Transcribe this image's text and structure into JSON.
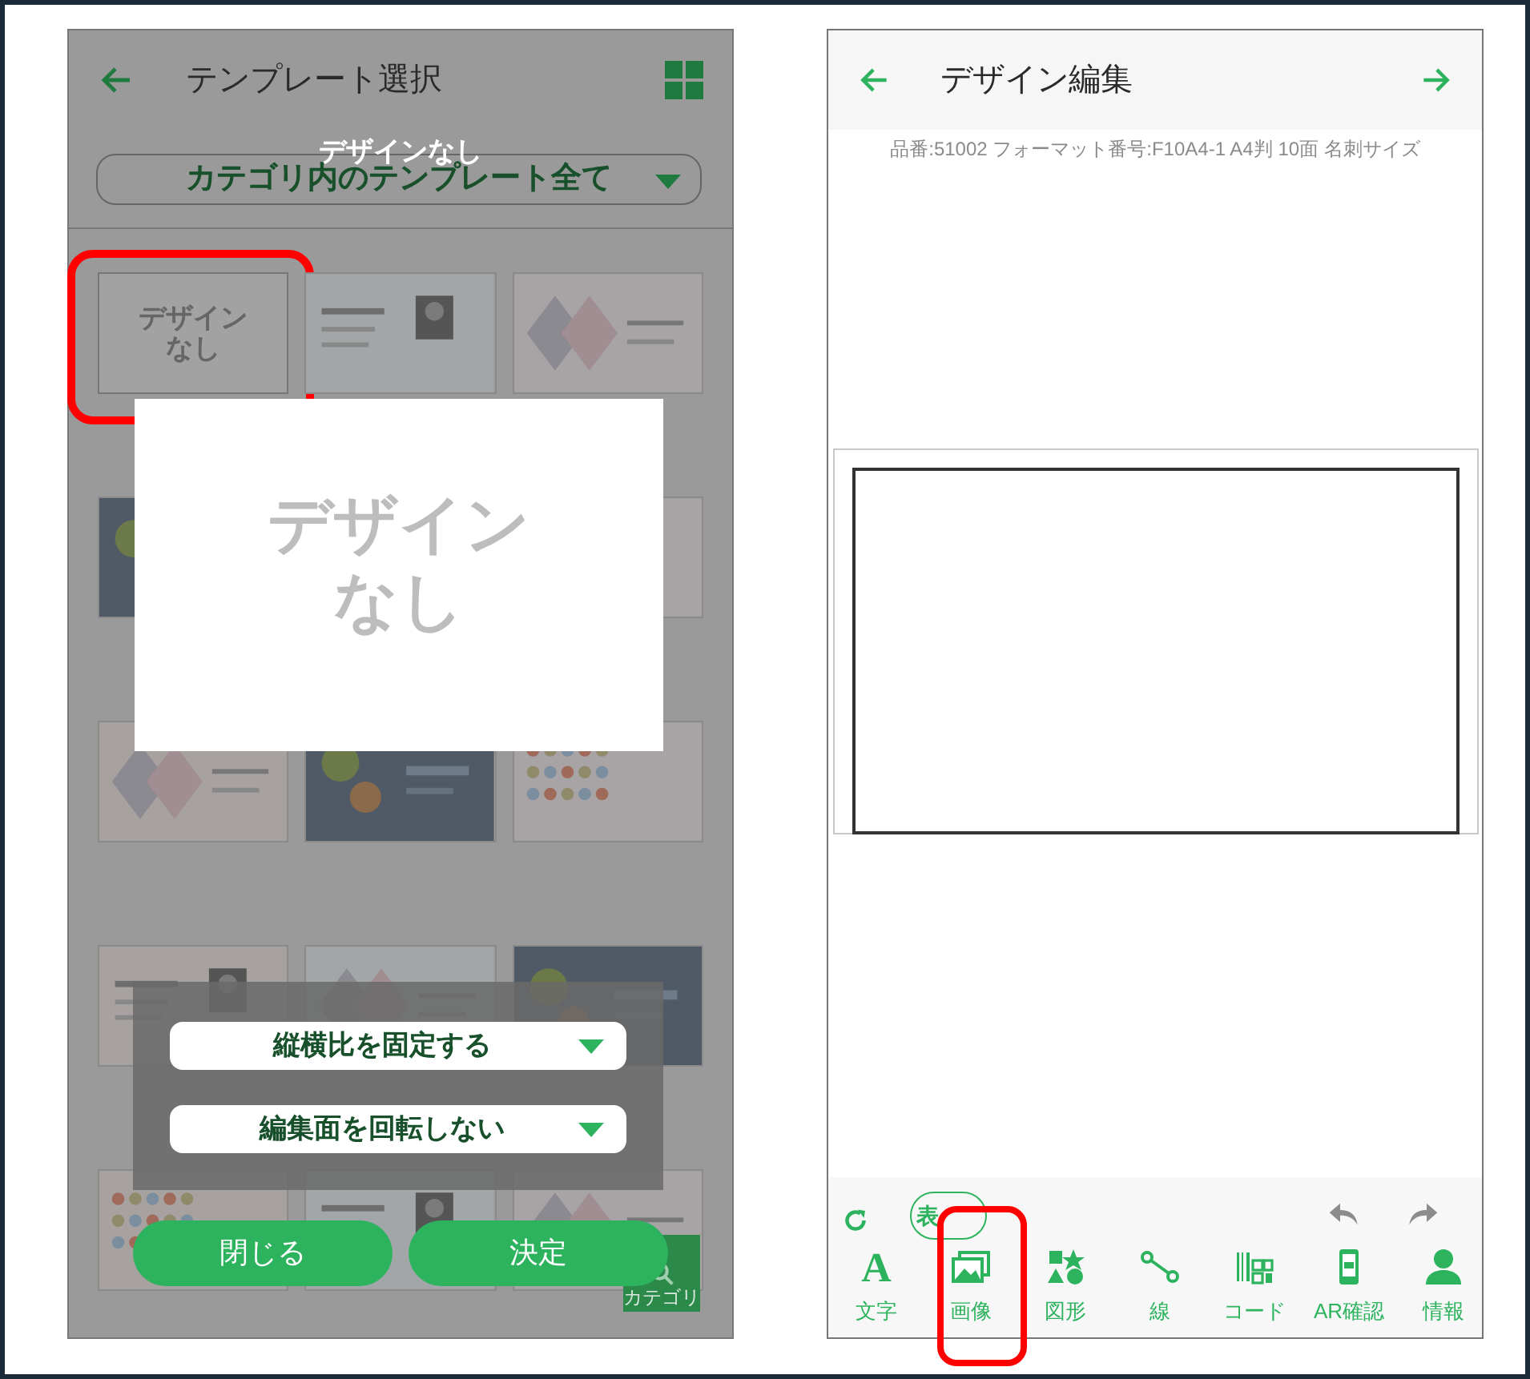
{
  "left_screen": {
    "title": "テンプレート選択",
    "selected_label": "デザインなし",
    "category_dropdown": "カテゴリ内のテンプレート全て",
    "templates": [
      {
        "kind": "blank",
        "label": "デザインなし",
        "highlighted": true
      },
      {
        "kind": "picture",
        "highlighted": false
      },
      {
        "kind": "picture",
        "highlighted": false
      },
      {
        "kind": "picture",
        "highlighted": false
      },
      {
        "kind": "hidden"
      },
      {
        "kind": "picture",
        "highlighted": false
      },
      {
        "kind": "picture",
        "highlighted": false
      },
      {
        "kind": "picture",
        "highlighted": false
      },
      {
        "kind": "picture",
        "highlighted": false
      },
      {
        "kind": "picture",
        "highlighted": false
      },
      {
        "kind": "picture",
        "highlighted": false
      },
      {
        "kind": "picture",
        "highlighted": false
      },
      {
        "kind": "picture",
        "highlighted": false
      },
      {
        "kind": "picture",
        "highlighted": false
      },
      {
        "kind": "picture",
        "highlighted": false
      }
    ],
    "preview": {
      "label": "デザインなし"
    },
    "options": [
      {
        "value": "縦横比を固定する"
      },
      {
        "value": "編集面を回転しない"
      }
    ],
    "buttons": [
      "閉じる",
      "決定"
    ],
    "category_button": "カテゴリ"
  },
  "right_screen": {
    "title": "デザイン編集",
    "info": "品番:51002 フォーマット番号:F10A4-1 A4判 10面 名刺サイズ",
    "side_toggle": "表",
    "tools": [
      {
        "kind": "text",
        "glyph": "A",
        "label": "文字",
        "highlighted": false
      },
      {
        "label": "画像",
        "highlighted": true
      },
      {
        "kind": "shape",
        "label": "図形",
        "highlighted": false
      },
      {
        "kind": "line",
        "label": "線",
        "highlighted": false
      },
      {
        "kind": "code",
        "label": "コード",
        "highlighted": false
      },
      {
        "kind": "ar",
        "label": "AR確認",
        "highlighted": false
      },
      {
        "kind": "info",
        "label": "情報",
        "highlighted": false
      }
    ]
  }
}
